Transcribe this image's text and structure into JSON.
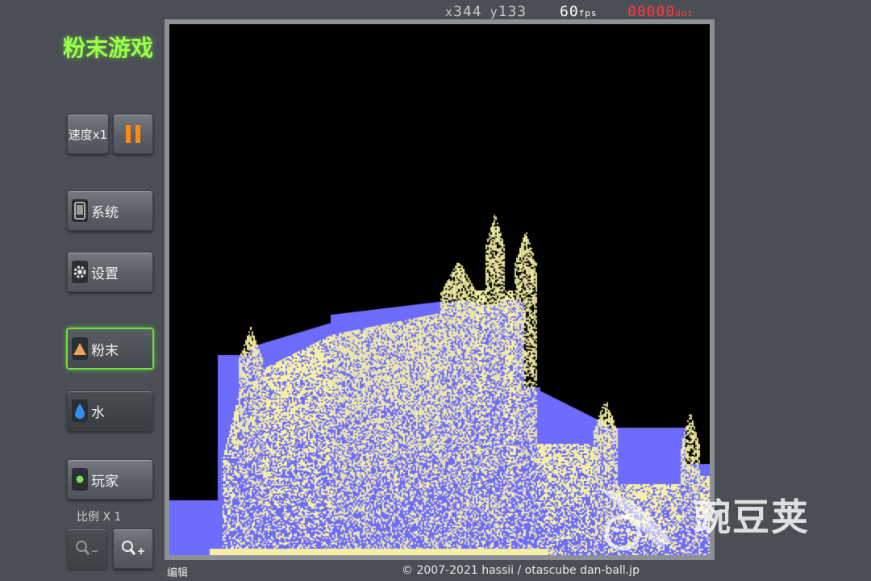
{
  "app": {
    "title": "粉末游戏"
  },
  "status": {
    "x_prefix": "x",
    "x_value": "344",
    "y_prefix": "y",
    "y_value": "133",
    "fps_value": "60",
    "fps_unit": "fps",
    "dot_value": "00000",
    "dot_unit": "dot"
  },
  "controls": {
    "speed_label": "速度x1",
    "pause_icon": "pause-icon",
    "system_label": "系统",
    "settings_label": "设置",
    "powder_label": "粉末",
    "water_label": "水",
    "player_label": "玩家",
    "scale_label": "比例 X 1"
  },
  "footer": {
    "edit_label": "编辑",
    "copyright": "© 2007-2021 hassii / otascube  dan-ball.jp"
  },
  "watermark": {
    "text": "豌豆荚"
  },
  "colors": {
    "background": "#4b4f55",
    "title": "#9cff4a",
    "powder": "#f5f0a6",
    "water": "#6e6cff",
    "pause_orange": "#ff8a12",
    "dot_red": "#ff3b3b",
    "active_border": "#6de03a"
  }
}
